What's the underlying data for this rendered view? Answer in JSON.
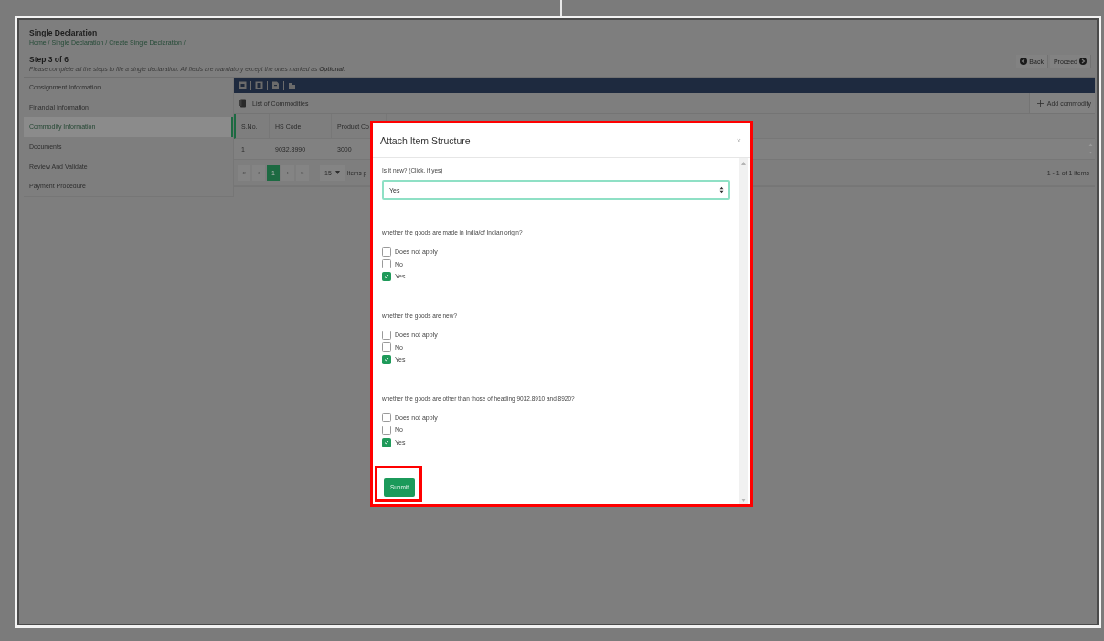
{
  "page": {
    "title": "Single Declaration",
    "breadcrumb": "Home / Single Declaration / Create Single Declaration /",
    "step": "Step 3 of 6",
    "instructions": "Please complete all the steps to file a single declaration. All fields are mandatory except the ones marked as **Optional**.",
    "actions": [
      {
        "kind": "back",
        "label": "Back"
      },
      {
        "kind": "proceed",
        "label": "Proceed"
      }
    ]
  },
  "steps": [
    {
      "label": "Consignment Information",
      "selected": false
    },
    {
      "label": "Financial Information",
      "selected": false
    },
    {
      "label": "Commodity Information",
      "selected": true
    },
    {
      "label": "Documents",
      "selected": false
    },
    {
      "label": "Review And Validate",
      "selected": false
    },
    {
      "label": "Payment Procedure",
      "selected": false
    }
  ],
  "commodities": {
    "title": "List of Commodities",
    "add_button": "Add commodity",
    "columns": [
      "S.No.",
      "HS Code",
      "Product Co"
    ],
    "rows": [
      [
        "1",
        "9032.8990",
        "3000"
      ]
    ],
    "pager": {
      "first": "«",
      "prev": "‹",
      "pages": [
        {
          "label": "1",
          "selected": true
        }
      ],
      "next": "›",
      "last": "»",
      "page_size": "15",
      "items_label": "Items p",
      "summary": "1 - 1 of 1 items"
    }
  },
  "modal": {
    "title": "Attach Item Structure",
    "close": "×",
    "highlighted": true,
    "fields": [
      {
        "kind": "select",
        "label": "Is it new? (Click, if yes)",
        "value": "Yes"
      },
      {
        "kind": "checkboxes",
        "label": "whether the goods are made in India/of Indian origin?",
        "options": [
          {
            "label": "Does not apply",
            "checked": false
          },
          {
            "label": "No",
            "checked": false
          },
          {
            "label": "Yes",
            "checked": true
          }
        ]
      },
      {
        "kind": "checkboxes",
        "label": "whether the goods are new?",
        "options": [
          {
            "label": "Does not apply",
            "checked": false
          },
          {
            "label": "No",
            "checked": false
          },
          {
            "label": "Yes",
            "checked": true
          }
        ]
      },
      {
        "kind": "checkboxes",
        "label": "whether the goods are other than those of heading 9032.8910 and 8920?",
        "options": [
          {
            "label": "Does not apply",
            "checked": false
          },
          {
            "label": "No",
            "checked": false
          },
          {
            "label": "Yes",
            "checked": true
          }
        ]
      }
    ],
    "submit": {
      "label": "Submit",
      "highlighted": true
    }
  }
}
